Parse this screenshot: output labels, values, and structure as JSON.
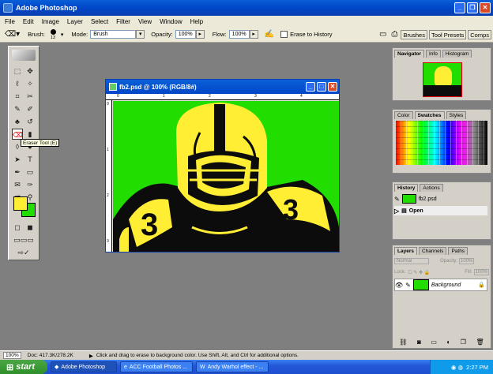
{
  "app": {
    "title": "Adobe Photoshop"
  },
  "menu": [
    "File",
    "Edit",
    "Image",
    "Layer",
    "Select",
    "Filter",
    "View",
    "Window",
    "Help"
  ],
  "options": {
    "brush_label": "Brush:",
    "brush_size": "13",
    "mode_label": "Mode:",
    "mode_value": "Brush",
    "opacity_label": "Opacity:",
    "opacity_value": "100%",
    "flow_label": "Flow:",
    "flow_value": "100%",
    "erase_history_label": "Erase to History",
    "tabs": [
      "Brushes",
      "Tool Presets",
      "Comps"
    ]
  },
  "tooltip": "Eraser Tool (E)",
  "document": {
    "title": "fb2.psd @ 100% (RGB/8#)",
    "background_color": "#22dd00",
    "ruler_marks": [
      "0",
      "1",
      "2",
      "3",
      "4"
    ],
    "vertical_marks": [
      "0",
      "1",
      "2",
      "3"
    ]
  },
  "navigator": {
    "tabs": [
      "Navigator",
      "Info",
      "Histogram"
    ]
  },
  "color_panel": {
    "tabs": [
      "Color",
      "Swatches",
      "Styles"
    ]
  },
  "history": {
    "tabs": [
      "History",
      "Actions"
    ],
    "snapshot": "fb2.psd",
    "step": "Open"
  },
  "layers": {
    "tabs": [
      "Layers",
      "Channels",
      "Paths"
    ],
    "blend": "Normal",
    "opacity_label": "Opacity:",
    "opacity": "100%",
    "lock_label": "Lock:",
    "fill_label": "Fill:",
    "fill": "100%",
    "layer_name": "Background"
  },
  "status": {
    "zoom": "100%",
    "doc": "Doc: 417.3K/278.2K",
    "hint": "Click and drag to erase to background color.  Use Shift, Alt, and Ctrl for additional options."
  },
  "taskbar": {
    "start": "start",
    "tasks": [
      "Adobe Photoshop",
      "ACC Football Photos ...",
      "Andy Warhol effect - ..."
    ],
    "clock": "2:27 PM"
  },
  "colors": {
    "foreground": "#ffee33",
    "background": "#22dd00"
  }
}
